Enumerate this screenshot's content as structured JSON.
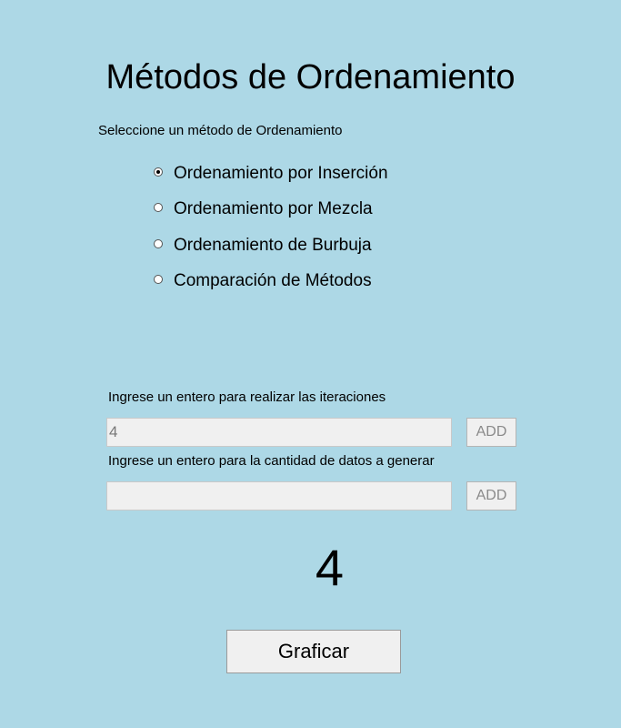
{
  "header": {
    "title": "Métodos de Ordenamiento",
    "subtitle": "Seleccione un método de Ordenamiento"
  },
  "methods": {
    "selected_index": 0,
    "options": [
      {
        "label": "Ordenamiento por Inserción",
        "checked": true
      },
      {
        "label": "Ordenamiento por Mezcla",
        "checked": false
      },
      {
        "label": "Ordenamiento de Burbuja",
        "checked": false
      },
      {
        "label": "Comparación de Métodos",
        "checked": false
      }
    ]
  },
  "iterations": {
    "label": "Ingrese un entero para realizar las iteraciones",
    "value": "4",
    "add_label": "ADD"
  },
  "data_count": {
    "label": "Ingrese un entero para la cantidad de datos a generar",
    "value": "",
    "add_label": "ADD"
  },
  "display": {
    "value": "4"
  },
  "actions": {
    "graph_label": "Graficar"
  },
  "colors": {
    "background": "#add8e6",
    "input_bg": "#f0f0f0",
    "button_bg": "#f0f0f0"
  }
}
